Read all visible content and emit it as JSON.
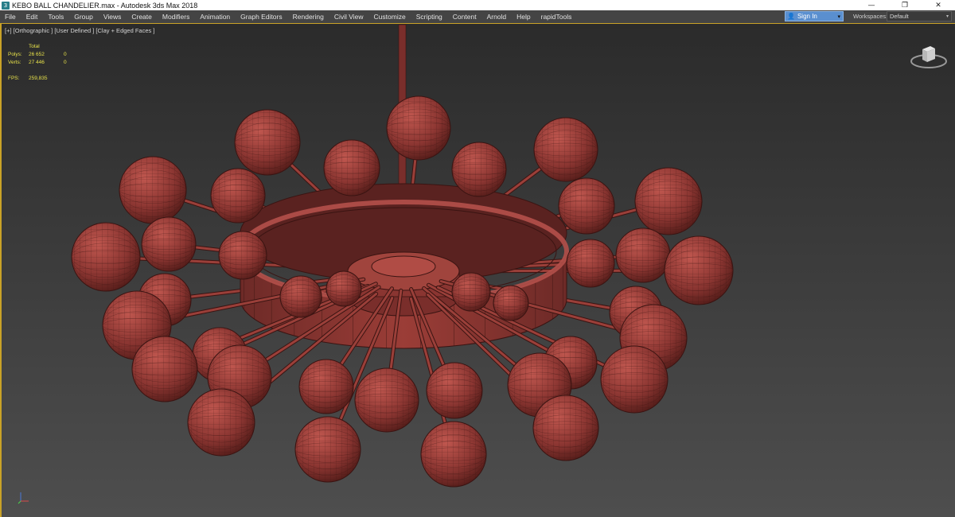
{
  "window": {
    "title": "KEBO BALL CHANDELIER.max - Autodesk 3ds Max 2018",
    "app_icon_glyph": "3",
    "controls": {
      "minimize": "—",
      "restore": "❐",
      "close": "✕"
    }
  },
  "menubar": {
    "items": [
      "File",
      "Edit",
      "Tools",
      "Group",
      "Views",
      "Create",
      "Modifiers",
      "Animation",
      "Graph Editors",
      "Rendering",
      "Civil View",
      "Customize",
      "Scripting",
      "Content",
      "Arnold",
      "Help",
      "rapidTools"
    ],
    "sign_in": {
      "label": "Sign In",
      "icon": "user-icon",
      "caret": "▾"
    },
    "workspaces": {
      "label": "Workspaces:",
      "value": "Default",
      "caret": "▾"
    }
  },
  "viewport": {
    "label": "[+] [Orthographic ] [User Defined ] [Clay + Edged Faces ]",
    "stats": {
      "header": "Total",
      "polys_label": "Polys:",
      "polys_total": "26 652",
      "polys_sel": "0",
      "verts_label": "Verts:",
      "verts_total": "27 446",
      "verts_sel": "0",
      "fps_label": "FPS:",
      "fps_value": "259,835"
    },
    "colors": {
      "clay": "#8a3531",
      "highlight": "#c0574f",
      "edge": "#3a1412",
      "stats": "#e8e24a",
      "border": "#c9a227"
    }
  }
}
